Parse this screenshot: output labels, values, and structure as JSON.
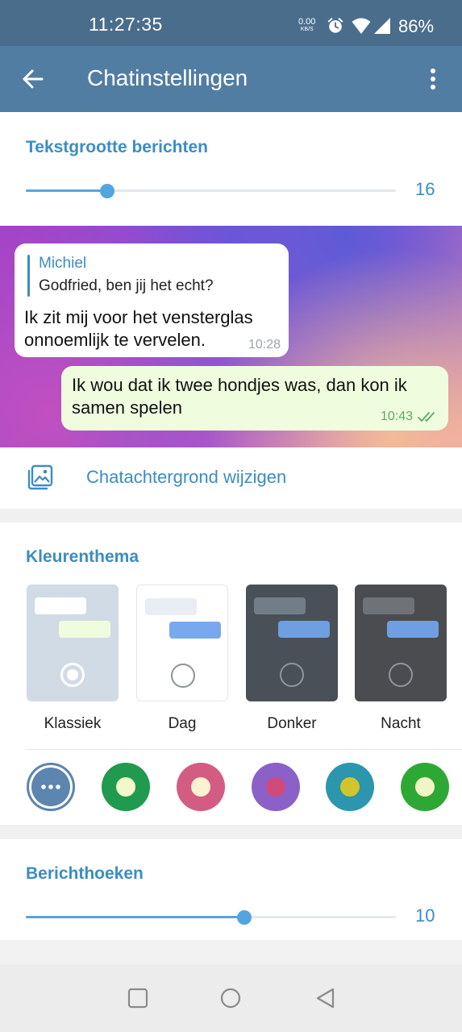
{
  "status_bar": {
    "time": "11:27:35",
    "net_speed": "0.00",
    "net_unit": "KB/S",
    "battery": "86%",
    "icons": [
      "alarm-icon",
      "wifi-icon",
      "signal-icon"
    ]
  },
  "app_bar": {
    "title": "Chatinstellingen",
    "back_icon": "arrow-left-icon",
    "menu_icon": "more-vert-icon"
  },
  "text_size": {
    "title": "Tekstgrootte berichten",
    "value": "16",
    "fraction": 0.22
  },
  "preview": {
    "incoming": {
      "reply_name": "Michiel",
      "reply_text": "Godfried, ben jij het echt?",
      "message": "Ik zit mij voor het vensterglas onnoemlijk te vervelen.",
      "time": "10:28"
    },
    "outgoing": {
      "message": "Ik wou dat ik twee hondjes was, dan kon ik samen spelen",
      "time": "10:43"
    }
  },
  "wallpaper": {
    "label": "Chatachtergrond wijzigen",
    "icon": "wallpaper-icon"
  },
  "color_theme": {
    "title": "Kleurenthema",
    "themes": [
      {
        "label": "Klassiek",
        "selected": true,
        "bg": "#d0dbe5",
        "bubble_in": "#ffffff",
        "bubble_out": "#effdde"
      },
      {
        "label": "Dag",
        "selected": false,
        "bg": "#ffffff",
        "bubble_in": "#e9eef4",
        "bubble_out": "#78a9ef"
      },
      {
        "label": "Donker",
        "selected": false,
        "bg": "#4a5058",
        "bubble_in": "#727d8a",
        "bubble_out": "#6f9fe0"
      },
      {
        "label": "Nacht",
        "selected": false,
        "bg": "#4a4c50",
        "bubble_in": "#6f7276",
        "bubble_out": "#6f9fe0"
      }
    ],
    "accents": [
      {
        "outer": "#5c85b0",
        "inner": "#5c85b0",
        "selected": true,
        "icon": "more-horiz-icon"
      },
      {
        "outer": "#1f9a4e",
        "inner": "#f3f7c9"
      },
      {
        "outer": "#d35d82",
        "inner": "#faf2d0"
      },
      {
        "outer": "#8b61c9",
        "inner": "#d04a7a"
      },
      {
        "outer": "#2b96ae",
        "inner": "#d2c52b"
      },
      {
        "outer": "#2ea835",
        "inner": "#f1f5c4"
      }
    ]
  },
  "corners": {
    "title": "Berichthoeken",
    "value": "10",
    "fraction": 0.59
  },
  "nav_bar": {
    "icons": [
      "square-icon",
      "circle-icon",
      "triangle-back-icon"
    ]
  }
}
